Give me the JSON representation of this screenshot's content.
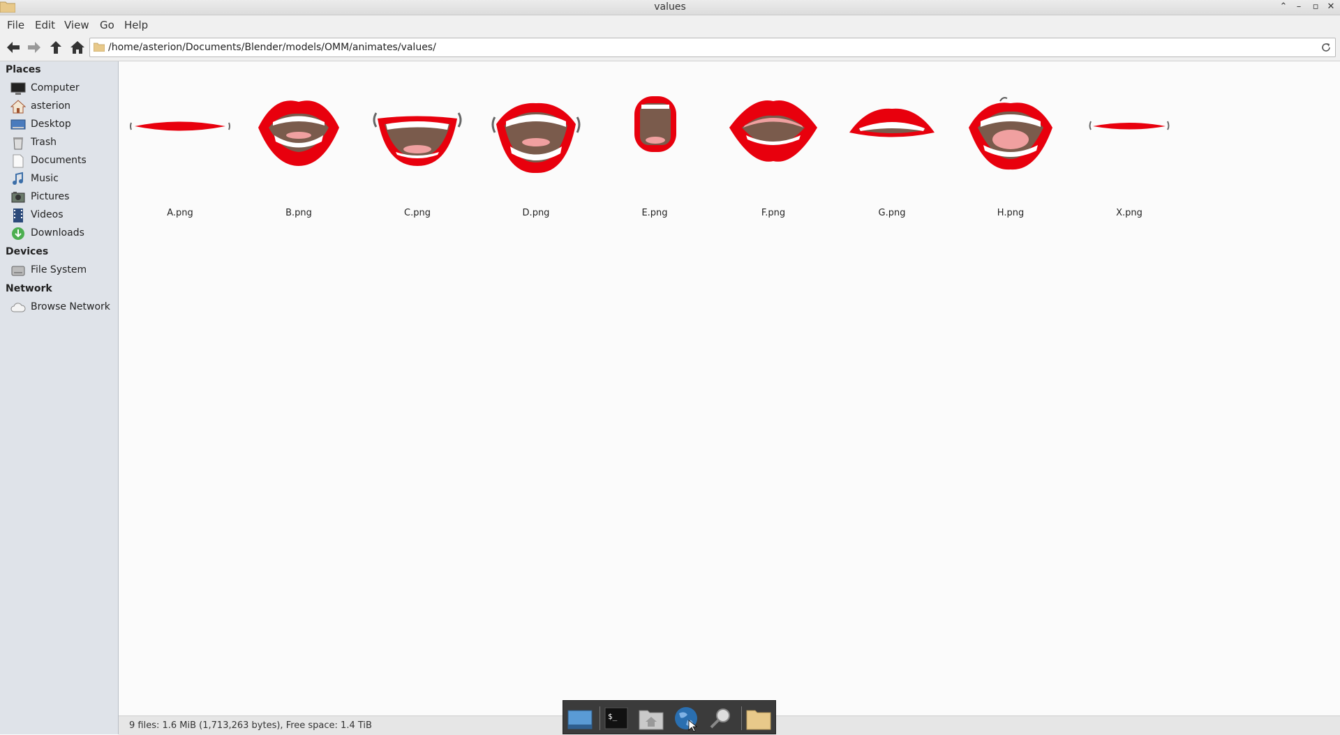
{
  "window": {
    "title": "values"
  },
  "menu": [
    "File",
    "Edit",
    "View",
    "Go",
    "Help"
  ],
  "location": {
    "path": "/home/asterion/Documents/Blender/models/OMM/animates/values/"
  },
  "sidebar": {
    "places_header": "Places",
    "places": [
      {
        "label": "Computer",
        "icon": "computer-icon"
      },
      {
        "label": "asterion",
        "icon": "home-icon"
      },
      {
        "label": "Desktop",
        "icon": "desktop-icon"
      },
      {
        "label": "Trash",
        "icon": "trash-icon"
      },
      {
        "label": "Documents",
        "icon": "documents-icon"
      },
      {
        "label": "Music",
        "icon": "music-icon"
      },
      {
        "label": "Pictures",
        "icon": "pictures-icon"
      },
      {
        "label": "Videos",
        "icon": "videos-icon"
      },
      {
        "label": "Downloads",
        "icon": "downloads-icon"
      }
    ],
    "devices_header": "Devices",
    "devices": [
      {
        "label": "File System",
        "icon": "drive-icon"
      }
    ],
    "network_header": "Network",
    "network": [
      {
        "label": "Browse Network",
        "icon": "network-icon"
      }
    ]
  },
  "files": [
    {
      "name": "A.png",
      "shape": "closed"
    },
    {
      "name": "B.png",
      "shape": "teeth-small"
    },
    {
      "name": "C.png",
      "shape": "smile-wide"
    },
    {
      "name": "D.png",
      "shape": "open-wide"
    },
    {
      "name": "E.png",
      "shape": "round-o"
    },
    {
      "name": "F.png",
      "shape": "pucker"
    },
    {
      "name": "G.png",
      "shape": "teeth-thin"
    },
    {
      "name": "H.png",
      "shape": "tongue"
    },
    {
      "name": "X.png",
      "shape": "closed-thin"
    }
  ],
  "status": {
    "text": "9 files: 1.6 MiB (1,713,263 bytes), Free space: 1.4 TiB"
  },
  "dock": [
    "show-desktop-icon",
    "terminal-icon",
    "home-folder-icon",
    "web-browser-icon",
    "search-icon",
    "folder-icon"
  ],
  "colors": {
    "lip": "#e8000d",
    "mouth": "#7a5b4c",
    "tongue": "#f0a0a0",
    "teeth": "#ffffff",
    "sidebar_bg": "#dfe3e9"
  }
}
